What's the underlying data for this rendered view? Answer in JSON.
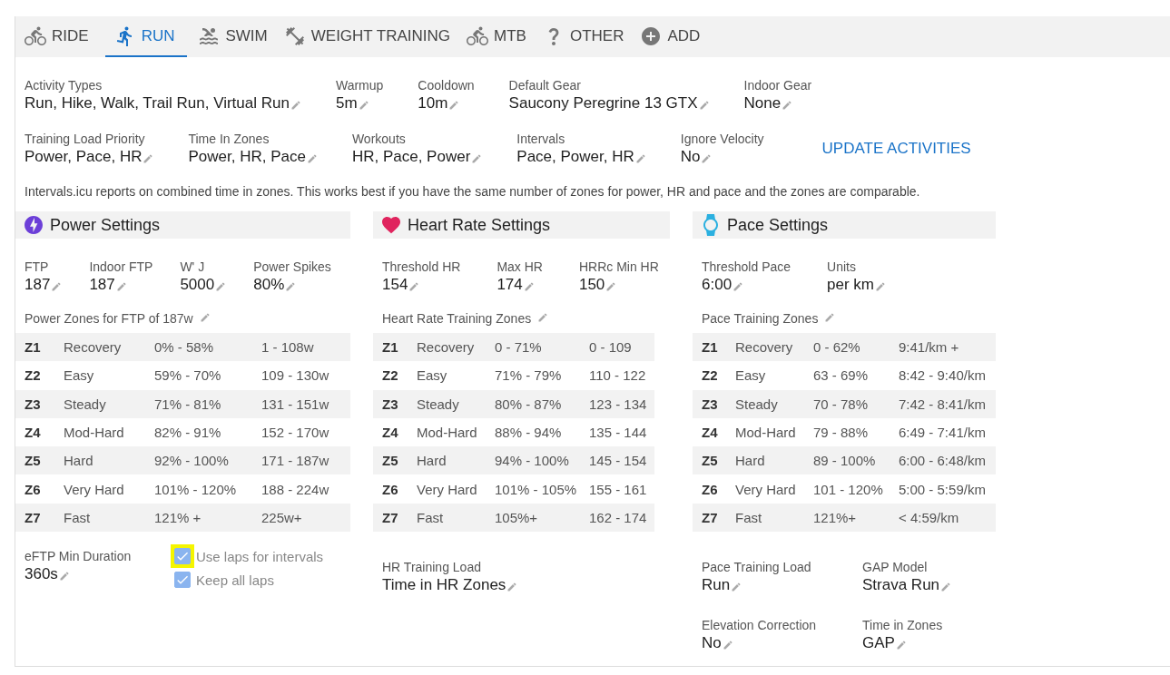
{
  "tabs": [
    {
      "label": "RIDE",
      "selected": false
    },
    {
      "label": "RUN",
      "selected": true
    },
    {
      "label": "SWIM",
      "selected": false
    },
    {
      "label": "WEIGHT TRAINING",
      "selected": false
    },
    {
      "label": "MTB",
      "selected": false
    },
    {
      "label": "OTHER",
      "selected": false
    },
    {
      "label": "ADD",
      "selected": false
    }
  ],
  "settings_rows": [
    [
      {
        "label": "Activity Types",
        "value": "Run, Hike, Walk, Trail Run, Virtual Run"
      },
      {
        "label": "Warmup",
        "value": "5m"
      },
      {
        "label": "Cooldown",
        "value": "10m"
      },
      {
        "label": "Default Gear",
        "value": "Saucony Peregrine 13 GTX"
      },
      {
        "label": "Indoor Gear",
        "value": "None"
      }
    ],
    [
      {
        "label": "Training Load Priority",
        "value": "Power, Pace, HR"
      },
      {
        "label": "Time In Zones",
        "value": "Power, HR, Pace"
      },
      {
        "label": "Workouts",
        "value": "HR, Pace, Power"
      },
      {
        "label": "Intervals",
        "value": "Pace, Power, HR"
      },
      {
        "label": "Ignore Velocity",
        "value": "No"
      }
    ]
  ],
  "update_button": "UPDATE ACTIVITIES",
  "note": "Intervals.icu reports on combined time in zones. This works best if you have the same number of zones for power, HR and pace and the zones are comparable.",
  "sections": [
    {
      "kind": "power",
      "title": "Power Settings",
      "fields": [
        {
          "label": "FTP",
          "value": "187"
        },
        {
          "label": "Indoor FTP",
          "value": "187"
        },
        {
          "label": "W' J",
          "value": "5000"
        },
        {
          "label": "Power Spikes",
          "value": "80%"
        }
      ],
      "zones_title": "Power Zones for FTP of 187w",
      "zones": [
        {
          "zone": "Z1",
          "name": "Recovery",
          "percent": "0% - 58%",
          "range": "1 - 108w"
        },
        {
          "zone": "Z2",
          "name": "Easy",
          "percent": "59% - 70%",
          "range": "109 - 130w"
        },
        {
          "zone": "Z3",
          "name": "Steady",
          "percent": "71% - 81%",
          "range": "131 - 151w"
        },
        {
          "zone": "Z4",
          "name": "Mod-Hard",
          "percent": "82% - 91%",
          "range": "152 - 170w"
        },
        {
          "zone": "Z5",
          "name": "Hard",
          "percent": "92% - 100%",
          "range": "171 - 187w"
        },
        {
          "zone": "Z6",
          "name": "Very Hard",
          "percent": "101% - 120%",
          "range": "188 - 224w"
        },
        {
          "zone": "Z7",
          "name": "Fast",
          "percent": "121% +",
          "range": "225w+"
        }
      ],
      "bottom_fields": [
        {
          "label": "eFTP Min Duration",
          "value": "360s"
        }
      ],
      "checkboxes": [
        {
          "label": "Use laps for intervals",
          "checked": true,
          "highlighted": true
        },
        {
          "label": "Keep all laps",
          "checked": true,
          "highlighted": false
        }
      ]
    },
    {
      "kind": "heart",
      "title": "Heart Rate Settings",
      "fields": [
        {
          "label": "Threshold HR",
          "value": "154"
        },
        {
          "label": "Max HR",
          "value": "174"
        },
        {
          "label": "HRRc Min HR",
          "value": "150"
        }
      ],
      "zones_title": "Heart Rate Training Zones",
      "zones": [
        {
          "zone": "Z1",
          "name": "Recovery",
          "percent": "0 - 71%",
          "range": "0 - 109"
        },
        {
          "zone": "Z2",
          "name": "Easy",
          "percent": "71% - 79%",
          "range": "110 - 122"
        },
        {
          "zone": "Z3",
          "name": "Steady",
          "percent": "80% - 87%",
          "range": "123 - 134"
        },
        {
          "zone": "Z4",
          "name": "Mod-Hard",
          "percent": "88% - 94%",
          "range": "135 - 144"
        },
        {
          "zone": "Z5",
          "name": "Hard",
          "percent": "94% - 100%",
          "range": "145 - 154"
        },
        {
          "zone": "Z6",
          "name": "Very Hard",
          "percent": "101% - 105%",
          "range": "155 - 161"
        },
        {
          "zone": "Z7",
          "name": "Fast",
          "percent": "105%+",
          "range": "162 - 174"
        }
      ],
      "bottom_fields": [
        {
          "label": "HR Training Load",
          "value": "Time in HR Zones"
        }
      ]
    },
    {
      "kind": "pace",
      "title": "Pace Settings",
      "fields": [
        {
          "label": "Threshold Pace",
          "value": "6:00"
        },
        {
          "label": "Units",
          "value": "per km"
        }
      ],
      "zones_title": "Pace Training Zones",
      "zones": [
        {
          "zone": "Z1",
          "name": "Recovery",
          "percent": "0 - 62%",
          "range": "9:41/km +"
        },
        {
          "zone": "Z2",
          "name": "Easy",
          "percent": "63 - 69%",
          "range": "8:42 - 9:40/km"
        },
        {
          "zone": "Z3",
          "name": "Steady",
          "percent": "70 - 78%",
          "range": "7:42 - 8:41/km"
        },
        {
          "zone": "Z4",
          "name": "Mod-Hard",
          "percent": "79 - 88%",
          "range": "6:49 - 7:41/km"
        },
        {
          "zone": "Z5",
          "name": "Hard",
          "percent": "89 - 100%",
          "range": "6:00 - 6:48/km"
        },
        {
          "zone": "Z6",
          "name": "Very Hard",
          "percent": "101 - 120%",
          "range": "5:00 - 5:59/km"
        },
        {
          "zone": "Z7",
          "name": "Fast",
          "percent": "121%+",
          "range": "< 4:59/km"
        }
      ],
      "bottom_fields": [
        {
          "label": "Pace Training Load",
          "value": "Run"
        },
        {
          "label": "GAP Model",
          "value": "Strava Run"
        },
        {
          "label": "Elevation Correction",
          "value": "No"
        },
        {
          "label": "Time in Zones",
          "value": "GAP"
        }
      ]
    }
  ]
}
